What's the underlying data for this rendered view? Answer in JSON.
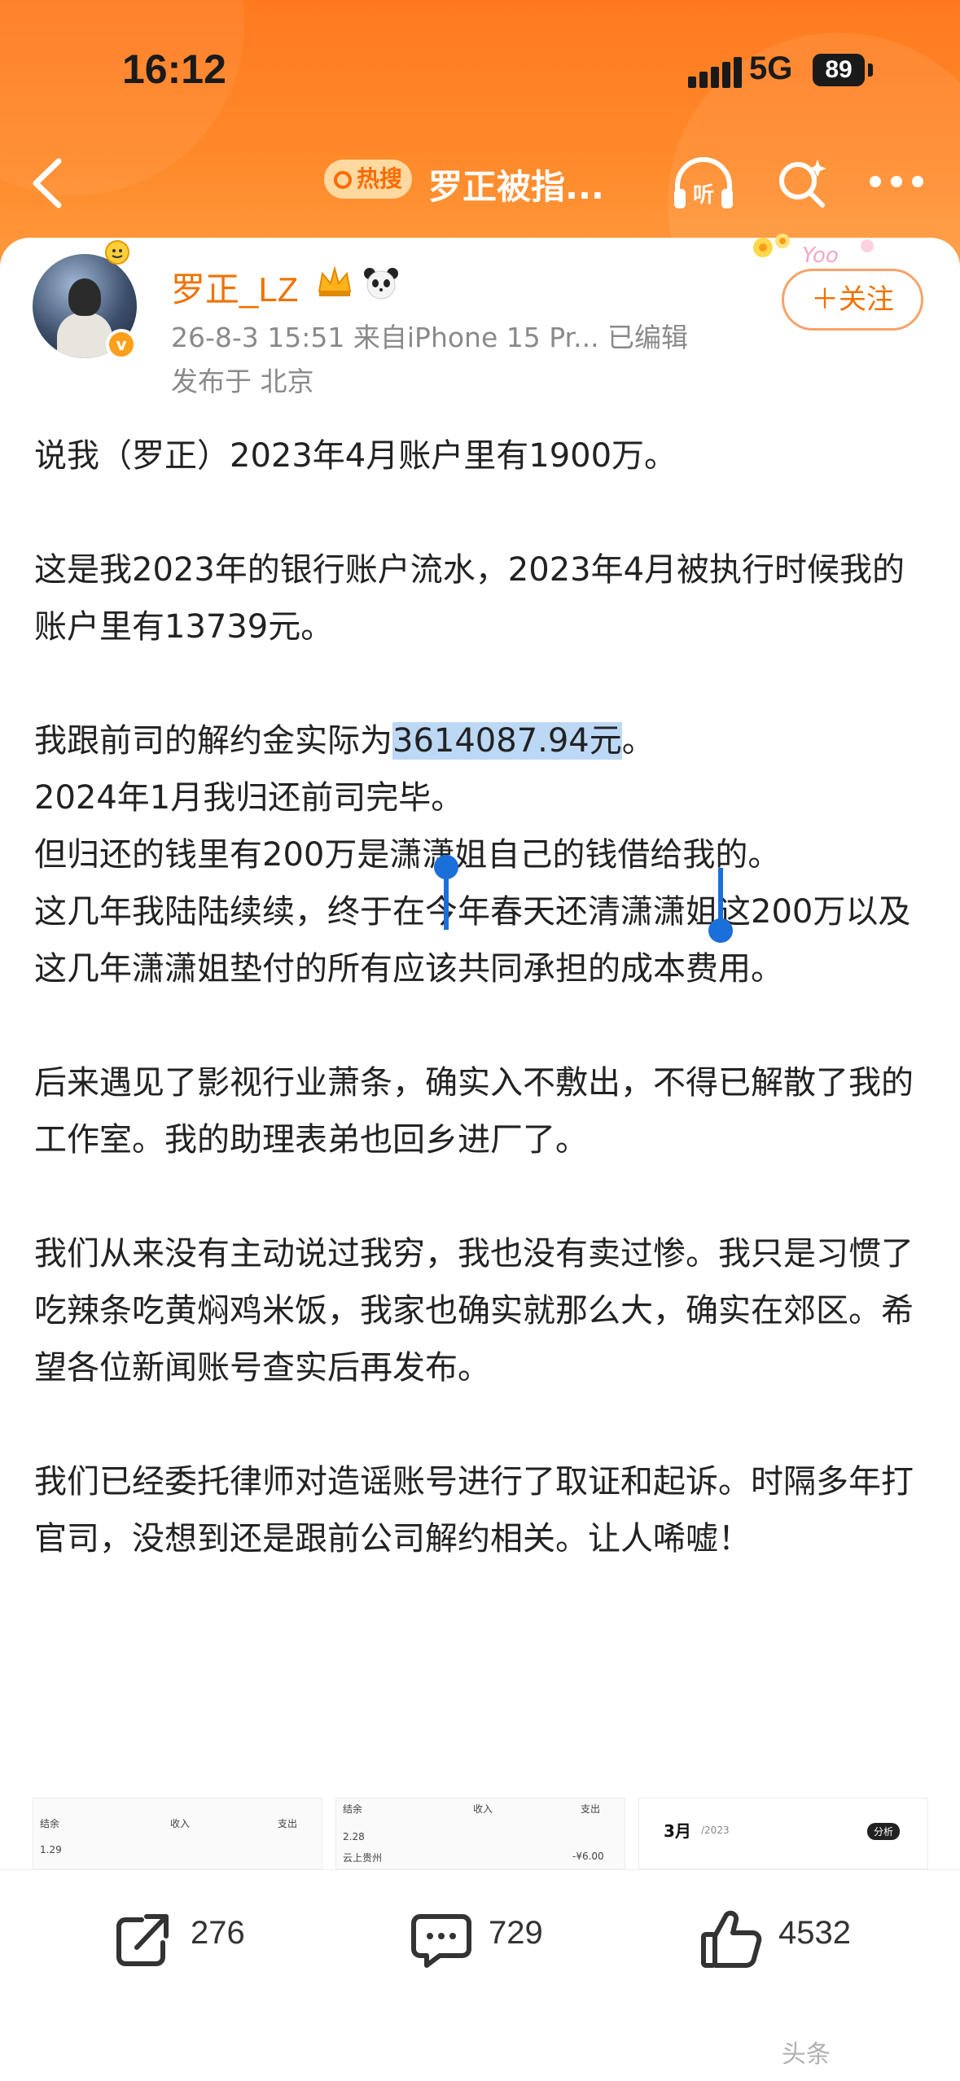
{
  "status_bar": {
    "time": "16:12",
    "network": "5G",
    "battery": "89"
  },
  "nav": {
    "hot_badge": "热搜",
    "title": "罗正被指..."
  },
  "author": {
    "name": "罗正_LZ",
    "meta": "26-8-3 15:51  来自iPhone 15 Pr...  已编辑",
    "location": "发布于 北京",
    "follow_label": "＋关注"
  },
  "post": {
    "p1": "说我（罗正）2023年4月账户里有1900万。",
    "p2": "这是我2023年的银行账户流水，2023年4月被执行时候我的账户里有13739元。",
    "p3_before": "我跟前司的解约金实际为",
    "p3_highlight": "3614087.94元",
    "p3_after": "。",
    "p4": "2024年1月我归还前司完毕。",
    "p5": "但归还的钱里有200万是潇潇姐自己的钱借给我的。",
    "p6": "这几年我陆陆续续，终于在今年春天还清潇潇姐这200万以及这几年潇潇姐垫付的所有应该共同承担的成本费用。",
    "p7": "后来遇见了影视行业萧条，确实入不敷出，不得已解散了我的工作室。我的助理表弟也回乡进厂了。",
    "p8": "我们从来没有主动说过我穷，我也没有卖过惨。我只是习惯了吃辣条吃黄焖鸡米饭，我家也确实就那么大，确实在郊区。希望各位新闻账号查实后再发布。",
    "p9": "我们已经委托律师对造谣账号进行了取证和起诉。时隔多年打官司，没想到还是跟前公司解约相关。让人唏嘘！"
  },
  "thumbnails": [
    {
      "col1": "结余",
      "col2": "收入",
      "col3": "支出",
      "val": "1.29"
    },
    {
      "col1": "结余",
      "col2": "收入",
      "col3": "支出",
      "val": "2.28",
      "row": "云上贵州",
      "amount": "-¥6.00"
    },
    {
      "month": "3月",
      "year": "/2023",
      "tag": "分析"
    }
  ],
  "actions": {
    "share_count": "276",
    "comment_count": "729",
    "like_count": "4532"
  },
  "watermark": "头条"
}
